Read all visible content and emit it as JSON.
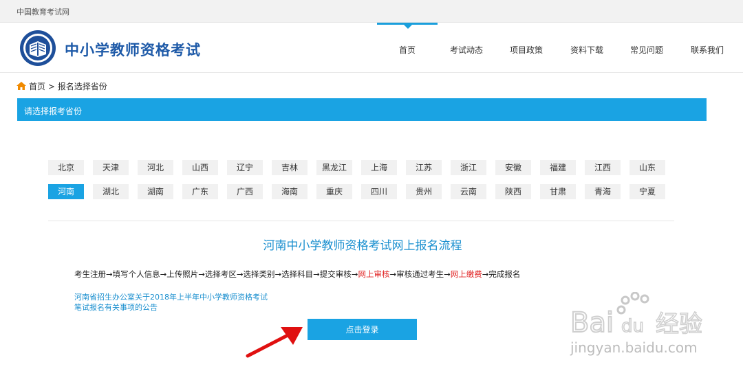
{
  "topbar": {
    "text": "中国教育考试网"
  },
  "header": {
    "title": "中小学教师资格考试",
    "nav": [
      {
        "label": "首页",
        "active": true
      },
      {
        "label": "考试动态"
      },
      {
        "label": "项目政策"
      },
      {
        "label": "资料下载"
      },
      {
        "label": "常见问题"
      },
      {
        "label": "联系我们"
      }
    ]
  },
  "breadcrumb": {
    "home": "首页",
    "separator": ">",
    "current": "报名选择省份"
  },
  "bluebar": {
    "title": "请选择报考省份"
  },
  "provinces": {
    "row1": [
      "北京",
      "天津",
      "河北",
      "山西",
      "辽宁",
      "吉林",
      "黑龙江",
      "上海",
      "江苏",
      "浙江",
      "安徽",
      "福建",
      "江西",
      "山东"
    ],
    "row2": [
      "河南",
      "湖北",
      "湖南",
      "广东",
      "广西",
      "海南",
      "重庆",
      "四川",
      "贵州",
      "云南",
      "陕西",
      "甘肃",
      "青海",
      "宁夏"
    ],
    "selected": "河南"
  },
  "flow": {
    "title": "河南中小学教师资格考试网上报名流程",
    "steps": [
      {
        "text": "考生注册→填写个人信息→上传照片→选择考区→选择类别→选择科目→提交审核→"
      },
      {
        "text": "网上审核",
        "highlight": true
      },
      {
        "text": "→审核通过考生→"
      },
      {
        "text": "网上缴费",
        "highlight": true
      },
      {
        "text": "→完成报名"
      }
    ]
  },
  "notice": {
    "line1": "河南省招生办公室关于2018年上半年中小学教师资格考试",
    "line2": "笔试报名有关事项的公告"
  },
  "login": {
    "label": "点击登录"
  },
  "watermark": {
    "brand": "Bai",
    "brand2": "du",
    "brand3": "经验",
    "url": "jingyan.baidu.com"
  },
  "colors": {
    "accent": "#1aa3e3",
    "highlight": "#e02020",
    "title": "#1e5aa8"
  }
}
